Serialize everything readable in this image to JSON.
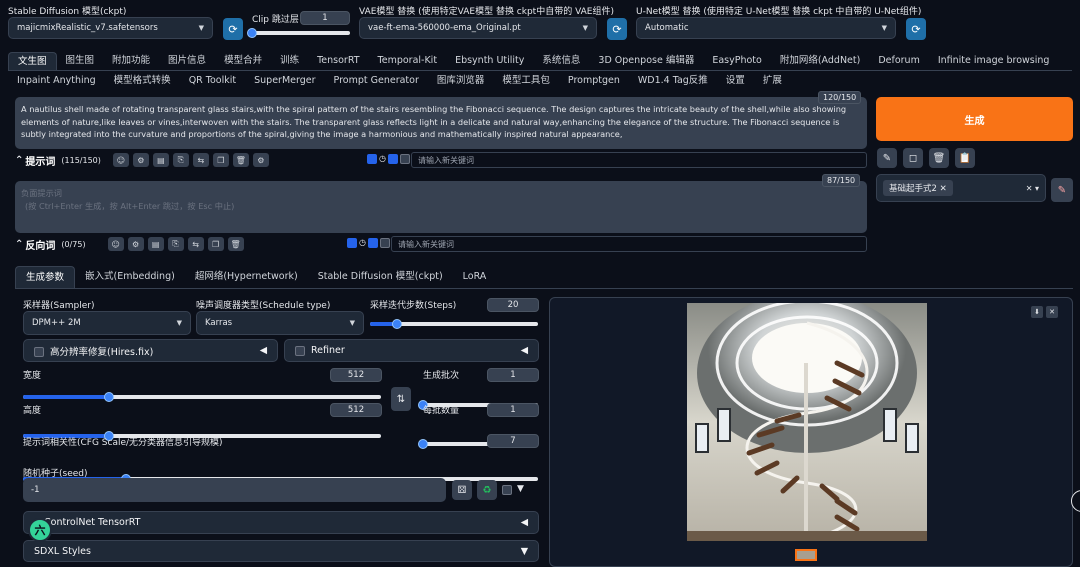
{
  "top": {
    "ckpt_label": "Stable Diffusion 模型(ckpt)",
    "ckpt_value": "majicmixRealistic_v7.safetensors",
    "clip_label": "Clip 跳过层",
    "clip_value": "1",
    "clip_fraction": 0.0,
    "vae_label": "VAE模型 替换 (使用特定VAE模型 替换 ckpt中自带的 VAE组件)",
    "vae_value": "vae-ft-ema-560000-ema_Original.pt",
    "unet_label": "U-Net模型 替换 (使用特定 U-Net模型 替换 ckpt 中自带的 U-Net组件)",
    "unet_value": "Automatic"
  },
  "tabs_row1": [
    "文生图",
    "图生图",
    "附加功能",
    "图片信息",
    "模型合并",
    "训练",
    "TensorRT",
    "Temporal-Kit",
    "Ebsynth Utility",
    "系统信息",
    "3D Openpose 编辑器",
    "EasyPhoto",
    "附加网络(AddNet)",
    "Deforum",
    "Infinite image browsing"
  ],
  "tabs_row2": [
    "Inpaint Anything",
    "模型格式转换",
    "QR Toolkit",
    "SuperMerger",
    "Prompt Generator",
    "图库浏览器",
    "模型工具包",
    "Promptgen",
    "WD1.4 Tag反推",
    "设置",
    "扩展"
  ],
  "prompt": {
    "text": "A nautilus shell made of rotating transparent glass stairs,with the spiral pattern of the stairs resembling the Fibonacci sequence. The design captures the intricate beauty of the shell,while also showing elements of nature,like leaves or vines,interwoven with the stairs. The transparent glass reflects light in a delicate and natural way,enhancing the elegance of the structure. The Fibonacci sequence is subtly integrated into the curvature and proportions of the spiral,giving the image a harmonious and mathematically inspired natural appearance,",
    "token_count": "120/150",
    "title": "提示词",
    "count": "(115/150)",
    "kw_placeholder": "请输入新关键词"
  },
  "negative": {
    "placeholder_line1": "负面提示词",
    "placeholder_line2": "(按 Ctrl+Enter 生成，按 Alt+Enter 跳过，按 Esc 中止)",
    "token_count": "87/150",
    "title": "反向词",
    "count": "(0/75)",
    "kw_placeholder": "请输入新关键词"
  },
  "generate_label": "生成",
  "style_tag": "基础起手式2",
  "param_tabs": [
    "生成参数",
    "嵌入式(Embedding)",
    "超网络(Hypernetwork)",
    "Stable Diffusion 模型(ckpt)",
    "LoRA"
  ],
  "params": {
    "sampler_label": "采样器(Sampler)",
    "sampler_value": "DPM++ 2M",
    "schedule_label": "噪声调度器类型(Schedule type)",
    "schedule_value": "Karras",
    "steps_label": "采样迭代步数(Steps)",
    "steps_value": "20",
    "steps_fraction": 0.16,
    "hires_label": "高分辨率修复(Hires.fix)",
    "refiner_label": "Refiner",
    "width_label": "宽度",
    "width_value": "512",
    "width_fraction": 0.24,
    "height_label": "高度",
    "height_value": "512",
    "height_fraction": 0.24,
    "batch_count_label": "生成批次",
    "batch_count_value": "1",
    "batch_count_fraction": 0.0,
    "batch_size_label": "每批数量",
    "batch_size_value": "1",
    "batch_size_fraction": 0.0,
    "cfg_label": "提示词相关性(CFG Scale/无分类器信息引导规模)",
    "cfg_value": "7",
    "cfg_fraction": 0.2,
    "seed_label": "随机种子(seed)",
    "seed_value": "-1",
    "controlnet_label": "ControlNet TensorRT",
    "sdxl_label": "SDXL Styles"
  },
  "floating_badge": "六",
  "colors": {
    "accent": "#f97316",
    "slider": "#2563eb",
    "refresh": "#1f6fa8"
  }
}
